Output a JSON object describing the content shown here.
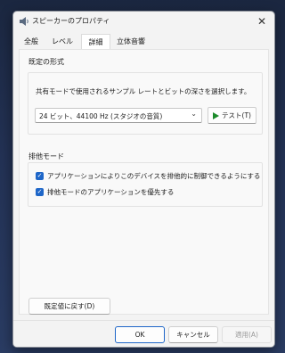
{
  "window": {
    "title": "スピーカーのプロパティ"
  },
  "tabs": [
    {
      "label": "全般"
    },
    {
      "label": "レベル"
    },
    {
      "label": "詳細"
    },
    {
      "label": "立体音響"
    }
  ],
  "default_format": {
    "group_label": "既定の形式",
    "description": "共有モードで使用されるサンプル レートとビットの深さを選択します。",
    "selected_format": "24 ビット、44100 Hz (スタジオの音質)",
    "test_button": "テスト(T)"
  },
  "exclusive_mode": {
    "group_label": "排他モード",
    "options": [
      {
        "label": "アプリケーションによりこのデバイスを排他的に制御できるようにする",
        "checked": true
      },
      {
        "label": "排他モードのアプリケーションを優先する",
        "checked": true
      }
    ]
  },
  "restore_defaults_button": "既定値に戻す(D)",
  "footer": {
    "ok": "OK",
    "cancel": "キャンセル",
    "apply": "適用(A)"
  },
  "colors": {
    "accent": "#1e66c8",
    "play": "#1b8a2a"
  },
  "icons": {
    "app": "speaker-icon",
    "close": "close-icon",
    "play": "play-icon",
    "dropdown": "chevron-down-icon",
    "check": "checkmark-icon"
  }
}
